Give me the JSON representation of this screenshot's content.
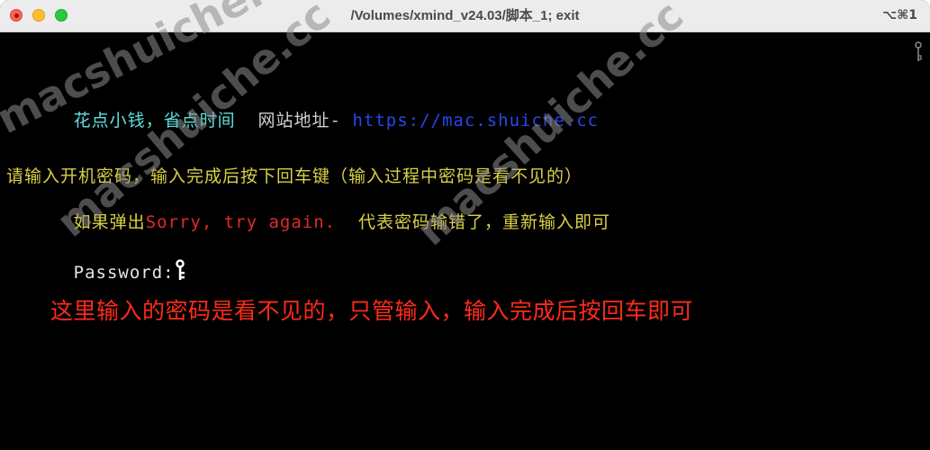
{
  "window": {
    "title": "/Volumes/xmind_v24.03/脚本_1; exit",
    "shortcut": "⌥⌘1",
    "traffic_lights": [
      "close",
      "minimize",
      "maximize"
    ]
  },
  "terminal": {
    "line1": {
      "slogan": "花点小钱，省点时间",
      "site_label": "网站地址-",
      "url": "https://mac.shuiche.cc"
    },
    "line2": "请输入开机密码，输入完成后按下回车键（输入过程中密码是看不见的）",
    "line3": {
      "prefix": "如果弹出",
      "error": "Sorry, try again.",
      "suffix": "代表密码输错了，重新输入即可"
    },
    "prompt": "Password:",
    "annotation": "这里输入的密码是看不见的，只管输入，输入完成后按回车即可"
  },
  "watermarks": [
    "macshuiche.cc",
    "macshuiche.cc",
    "macshuiche.cc"
  ],
  "colors": {
    "slogan": "#5fe0e0",
    "url": "#2a47e8",
    "instructions": "#d9d046",
    "error": "#e02a2a",
    "annotation": "#ff2a1a"
  },
  "icons": {
    "cursor": "key-icon",
    "scroll_indicator": "key-icon"
  }
}
